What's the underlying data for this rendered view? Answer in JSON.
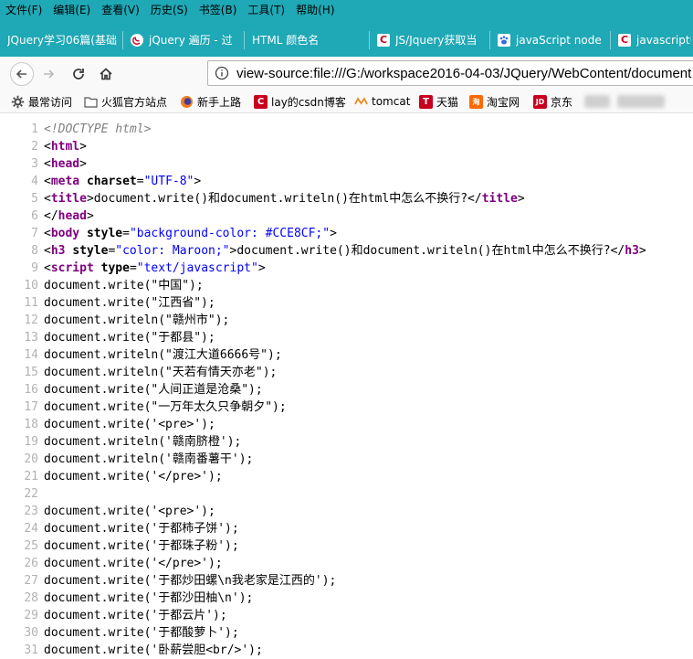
{
  "menubar": [
    "文件(F)",
    "编辑(E)",
    "查看(V)",
    "历史(S)",
    "书签(B)",
    "工具(T)",
    "帮助(H)"
  ],
  "tabs": [
    {
      "label": "JQuery学习06篇(基础",
      "icon": "none"
    },
    {
      "label": "jQuery 遍历 - 过",
      "icon": "jquery-icon"
    },
    {
      "label": "HTML 颜色名",
      "icon": "none"
    },
    {
      "label": "JS/Jquery获取当",
      "icon": "csdn-icon"
    },
    {
      "label": "javaScript node",
      "icon": "baidu-paw-icon"
    },
    {
      "label": "javascript中",
      "icon": "csdn-icon"
    }
  ],
  "url": "view-source:file:///G:/workspace2016-04-03/JQuery/WebContent/document",
  "bookmarks": [
    {
      "label": "最常访问",
      "icon": "gear-icon"
    },
    {
      "label": "火狐官方站点",
      "icon": "folder-icon"
    },
    {
      "label": "新手上路",
      "icon": "firefox-icon"
    },
    {
      "label": "lay的csdn博客",
      "icon": "csdn-icon"
    },
    {
      "label": "tomcat",
      "icon": "tomcat-icon"
    },
    {
      "label": "天猫",
      "icon": "tmall-icon"
    },
    {
      "label": "淘宝网",
      "icon": "taobao-icon"
    },
    {
      "label": "京东",
      "icon": "jd-icon"
    }
  ],
  "source_lines": [
    {
      "n": "1",
      "tokens": [
        [
          "c-comment",
          "<!DOCTYPE html>"
        ]
      ]
    },
    {
      "n": "2",
      "tokens": [
        [
          "c-punct",
          "<"
        ],
        [
          "c-tag",
          "html"
        ],
        [
          "c-punct",
          ">"
        ]
      ]
    },
    {
      "n": "3",
      "tokens": [
        [
          "c-punct",
          "<"
        ],
        [
          "c-tag",
          "head"
        ],
        [
          "c-punct",
          ">"
        ]
      ]
    },
    {
      "n": "4",
      "tokens": [
        [
          "c-punct",
          "<"
        ],
        [
          "c-tag",
          "meta"
        ],
        [
          "c-punct",
          " "
        ],
        [
          "c-attr",
          "charset"
        ],
        [
          "c-punct",
          "="
        ],
        [
          "c-val",
          "\"UTF-8\""
        ],
        [
          "c-punct",
          ">"
        ]
      ]
    },
    {
      "n": "5",
      "tokens": [
        [
          "c-punct",
          "<"
        ],
        [
          "c-tag",
          "title"
        ],
        [
          "c-punct",
          ">"
        ],
        [
          "c-text",
          "document.write()和document.writeln()在html中怎么不换行?"
        ],
        [
          "c-punct",
          "</"
        ],
        [
          "c-tag",
          "title"
        ],
        [
          "c-punct",
          ">"
        ]
      ]
    },
    {
      "n": "6",
      "tokens": [
        [
          "c-punct",
          "</"
        ],
        [
          "c-tag",
          "head"
        ],
        [
          "c-punct",
          ">"
        ]
      ]
    },
    {
      "n": "7",
      "tokens": [
        [
          "c-punct",
          "<"
        ],
        [
          "c-tag",
          "body"
        ],
        [
          "c-punct",
          " "
        ],
        [
          "c-attr",
          "style"
        ],
        [
          "c-punct",
          "="
        ],
        [
          "c-val",
          "\"background-color: #CCE8CF;\""
        ],
        [
          "c-punct",
          ">"
        ]
      ]
    },
    {
      "n": "8",
      "tokens": [
        [
          "c-punct",
          "<"
        ],
        [
          "c-tag",
          "h3"
        ],
        [
          "c-punct",
          " "
        ],
        [
          "c-attr",
          "style"
        ],
        [
          "c-punct",
          "="
        ],
        [
          "c-val",
          "\"color: Maroon;\""
        ],
        [
          "c-punct",
          ">"
        ],
        [
          "c-text",
          "document.write()和document.writeln()在html中怎么不换行?"
        ],
        [
          "c-punct",
          "</"
        ],
        [
          "c-tag",
          "h3"
        ],
        [
          "c-punct",
          ">"
        ]
      ]
    },
    {
      "n": "9",
      "tokens": [
        [
          "c-punct",
          "<"
        ],
        [
          "c-tag",
          "script"
        ],
        [
          "c-punct",
          " "
        ],
        [
          "c-attr",
          "type"
        ],
        [
          "c-punct",
          "="
        ],
        [
          "c-val",
          "\"text/javascript\""
        ],
        [
          "c-punct",
          ">"
        ]
      ]
    },
    {
      "n": "10",
      "tokens": [
        [
          "c-text",
          "document.write(\"中国\");"
        ]
      ]
    },
    {
      "n": "11",
      "tokens": [
        [
          "c-text",
          "document.write(\"江西省\");"
        ]
      ]
    },
    {
      "n": "12",
      "tokens": [
        [
          "c-text",
          "document.writeln(\"赣州市\");"
        ]
      ]
    },
    {
      "n": "13",
      "tokens": [
        [
          "c-text",
          "document.write(\"于都县\");"
        ]
      ]
    },
    {
      "n": "14",
      "tokens": [
        [
          "c-text",
          "document.writeln(\"渡江大道6666号\");"
        ]
      ]
    },
    {
      "n": "15",
      "tokens": [
        [
          "c-text",
          "document.writeln(\"天若有情天亦老\");"
        ]
      ]
    },
    {
      "n": "16",
      "tokens": [
        [
          "c-text",
          "document.write(\"人间正道是沧桑\");"
        ]
      ]
    },
    {
      "n": "17",
      "tokens": [
        [
          "c-text",
          "document.write(\"一万年太久只争朝夕\");"
        ]
      ]
    },
    {
      "n": "18",
      "tokens": [
        [
          "c-text",
          "document.write('<pre>');"
        ]
      ]
    },
    {
      "n": "19",
      "tokens": [
        [
          "c-text",
          "document.writeln('赣南脐橙');"
        ]
      ]
    },
    {
      "n": "20",
      "tokens": [
        [
          "c-text",
          "document.writeln('赣南番薯干');"
        ]
      ]
    },
    {
      "n": "21",
      "tokens": [
        [
          "c-text",
          "document.write('</pre>');"
        ]
      ]
    },
    {
      "n": "22",
      "tokens": []
    },
    {
      "n": "23",
      "tokens": [
        [
          "c-text",
          "document.write('<pre>');"
        ]
      ]
    },
    {
      "n": "24",
      "tokens": [
        [
          "c-text",
          "document.write('于都柿子饼');"
        ]
      ]
    },
    {
      "n": "25",
      "tokens": [
        [
          "c-text",
          "document.write('于都珠子粉');"
        ]
      ]
    },
    {
      "n": "26",
      "tokens": [
        [
          "c-text",
          "document.write('</pre>');"
        ]
      ]
    },
    {
      "n": "27",
      "tokens": [
        [
          "c-text",
          "document.write('于都炒田螺\\n我老家是江西的');"
        ]
      ]
    },
    {
      "n": "28",
      "tokens": [
        [
          "c-text",
          "document.write('于都沙田柚\\n');"
        ]
      ]
    },
    {
      "n": "29",
      "tokens": [
        [
          "c-text",
          "document.write('于都云片');"
        ]
      ]
    },
    {
      "n": "30",
      "tokens": [
        [
          "c-text",
          "document.write('于都酸萝卜');"
        ]
      ]
    },
    {
      "n": "31",
      "tokens": [
        [
          "c-text",
          "document.write('卧薪尝胆<br/>');"
        ]
      ]
    }
  ]
}
